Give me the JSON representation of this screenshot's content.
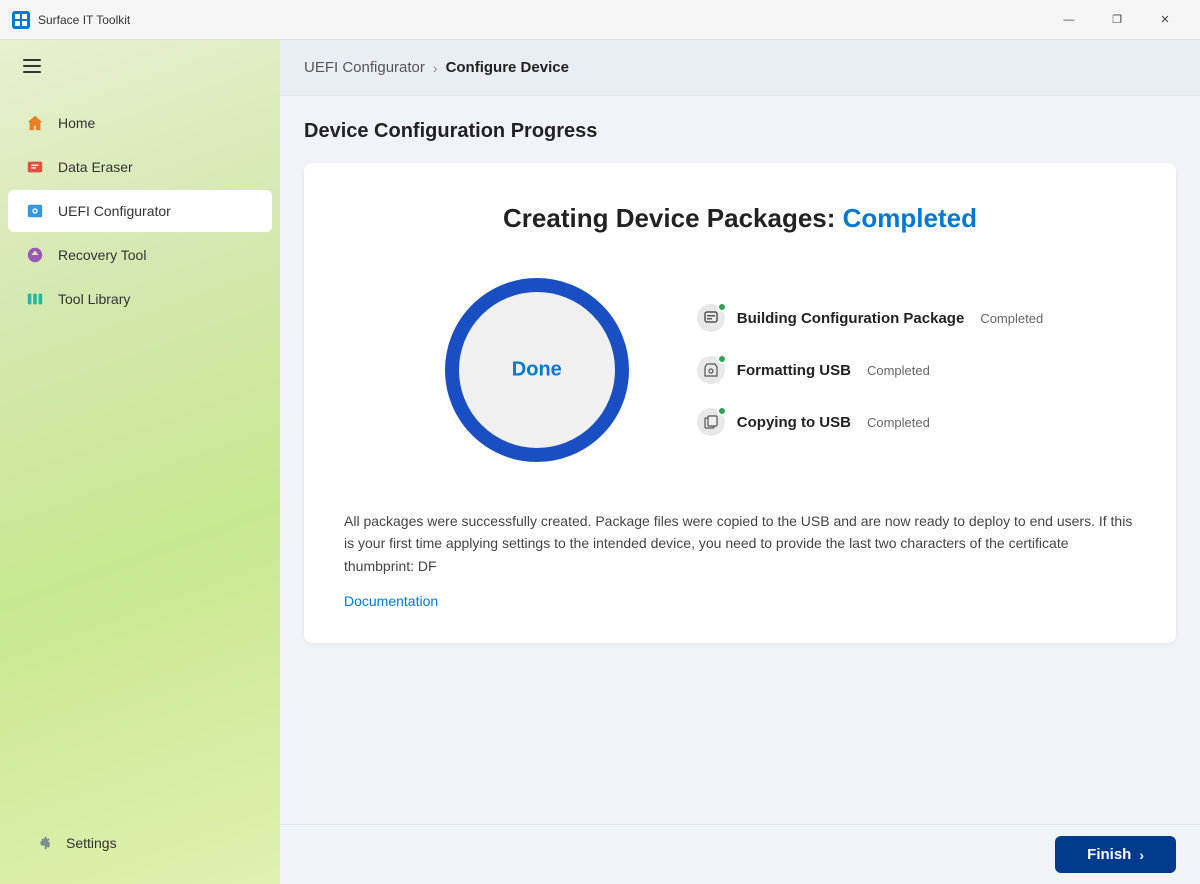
{
  "titleBar": {
    "appName": "Surface IT Toolkit",
    "controls": {
      "minimize": "—",
      "maximize": "❐",
      "close": "✕"
    }
  },
  "sidebar": {
    "navItems": [
      {
        "id": "home",
        "label": "Home",
        "icon": "home"
      },
      {
        "id": "data-eraser",
        "label": "Data Eraser",
        "icon": "erase"
      },
      {
        "id": "uefi-configurator",
        "label": "UEFI Configurator",
        "icon": "uefi",
        "active": true
      },
      {
        "id": "recovery-tool",
        "label": "Recovery Tool",
        "icon": "recovery"
      },
      {
        "id": "tool-library",
        "label": "Tool Library",
        "icon": "library"
      }
    ],
    "footerItems": [
      {
        "id": "settings",
        "label": "Settings",
        "icon": "settings"
      }
    ]
  },
  "breadcrumb": {
    "parent": "UEFI Configurator",
    "separator": "›",
    "current": "Configure Device"
  },
  "pageTitle": "Device Configuration Progress",
  "card": {
    "heading": "Creating Device Packages:",
    "headingCompleted": "Completed",
    "circleLabel": "Done",
    "steps": [
      {
        "id": "building",
        "name": "Building Configuration Package",
        "status": "Completed"
      },
      {
        "id": "formatting",
        "name": "Formatting USB",
        "status": "Completed"
      },
      {
        "id": "copying",
        "name": "Copying to USB",
        "status": "Completed"
      }
    ],
    "description": "All packages were successfully created. Package files were copied to the USB and are now ready to deploy to end users. If this is your first time applying settings to the intended device, you need to provide the last two characters of the certificate thumbprint: DF",
    "docLinkText": "Documentation"
  },
  "footer": {
    "finishLabel": "Finish"
  }
}
